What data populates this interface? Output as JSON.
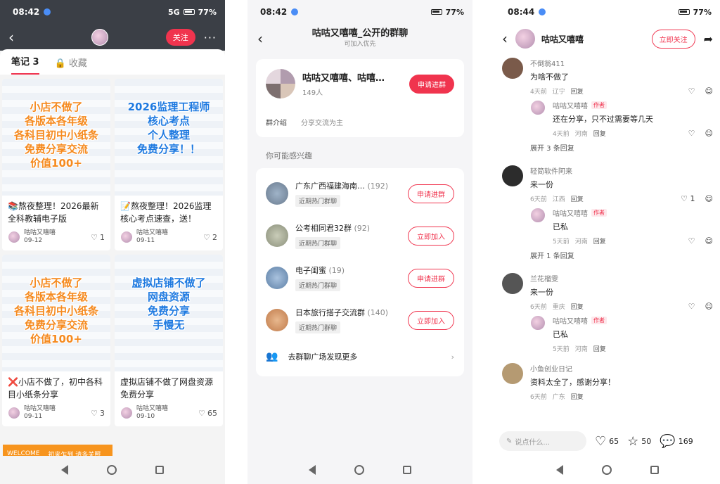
{
  "panel1": {
    "status": {
      "time": "08:42",
      "battery": "77%",
      "signal": "5G"
    },
    "header": {
      "follow_label": "关注",
      "more": "···"
    },
    "tabs": [
      {
        "label": "笔记 3"
      },
      {
        "label": "收藏"
      }
    ],
    "cards": [
      {
        "overlay": "小店不做了\n各版本各年级\n各科目初中小纸条\n免费分享交流\n价值100+",
        "overlay_color": "orange",
        "title": "📚熬夜整理！2026最新全科教辅电子版",
        "author": "咕咕又嘻嘻",
        "date": "09-12",
        "likes": "1"
      },
      {
        "overlay": "2026监理工程师\n核心考点\n个人整理\n免费分享！！",
        "overlay_color": "blue",
        "title": "📝熬夜整理！2026监理核心考点速查，送！",
        "author": "咕咕又嘻嘻",
        "date": "09-11",
        "likes": "2"
      },
      {
        "overlay": "小店不做了\n各版本各年级\n各科目初中小纸条\n免费分享交流\n价值100+",
        "overlay_color": "orange",
        "title": "❌小店不做了，初中各科目小纸条分享",
        "author": "咕咕又嘻嘻",
        "date": "09-11",
        "likes": "3"
      },
      {
        "overlay": "虚拟店铺不做了\n网盘资源\n免费分享\n手慢无",
        "overlay_color": "blue",
        "title": "虚拟店铺不做了网盘资源免费分享",
        "author": "咕咕又嘻嘻",
        "date": "09-10",
        "likes": "65"
      }
    ],
    "welcome": {
      "left": "WELCOME",
      "right": "初来乍到 请多关照"
    }
  },
  "panel2": {
    "status": {
      "time": "08:42",
      "battery": "77%"
    },
    "header": {
      "title": "咕咕又嘻嘻_公开的群聊",
      "subtitle": "可加入优先"
    },
    "group": {
      "name": "咕咕又嘻嘻、咕嘻…",
      "count": "149人",
      "join_label": "申请进群",
      "intro_key": "群介绍",
      "intro_value": "分享交流为主"
    },
    "section_title": "你可能感兴趣",
    "recs": [
      {
        "name": "广东广西福建海南…",
        "count": "(192)",
        "tag": "近期热门群聊",
        "action": "申请进群",
        "color": "#6a7b8f"
      },
      {
        "name": "公考相同君32群",
        "count": "(92)",
        "tag": "近期热门群聊",
        "action": "立即加入",
        "color": "#8a8f7a"
      },
      {
        "name": "电子闺蜜",
        "count": "(19)",
        "tag": "近期热门群聊",
        "action": "申请进群",
        "color": "#5c7fa6"
      },
      {
        "name": "日本旅行搭子交流群",
        "count": "(140)",
        "tag": "近期热门群聊",
        "action": "立即加入",
        "color": "#c07a4a"
      }
    ],
    "more_label": "去群聊广场发现更多"
  },
  "panel3": {
    "status": {
      "time": "08:44",
      "battery": "77%"
    },
    "header": {
      "name": "咕咕又嘻嘻",
      "follow_label": "立即关注"
    },
    "comments": [
      {
        "user": "不倒翁411",
        "text": "为啥不做了",
        "time": "4天前",
        "loc": "辽宁",
        "reply": "回复",
        "likes": "",
        "color": "#7a5a4a",
        "sub": {
          "user": "咕咕又嘻嘻",
          "tag": "作者",
          "text": "还在分享，只不过需要等几天",
          "time": "4天前",
          "loc": "河南",
          "reply": "回复"
        },
        "expand": "展开 3 条回复"
      },
      {
        "user": "轻简软件阿来",
        "text": "来一份",
        "time": "6天前",
        "loc": "江西",
        "reply": "回复",
        "likes": "1",
        "color": "#2c2c2c",
        "sub": {
          "user": "咕咕又嘻嘻",
          "tag": "作者",
          "text": "已私",
          "time": "5天前",
          "loc": "河南",
          "reply": "回复"
        },
        "expand": "展开 1 条回复"
      },
      {
        "user": "兰花榴雯",
        "text": "来一份",
        "time": "6天前",
        "loc": "重庆",
        "reply": "回复",
        "likes": "",
        "color": "#555555",
        "sub": {
          "user": "咕咕又嘻嘻",
          "tag": "作者",
          "text": "已私",
          "time": "5天前",
          "loc": "河南",
          "reply": "回复"
        },
        "expand": ""
      },
      {
        "user": "小鱼创业日记",
        "text": "资料太全了，感谢分享！",
        "time": "6天前",
        "loc": "广东",
        "reply": "回复",
        "likes": "",
        "color": "#b59a72",
        "sub": null,
        "expand": ""
      }
    ],
    "bottom": {
      "placeholder": "说点什么...",
      "likes": "65",
      "stars": "50",
      "comments": "169"
    }
  }
}
